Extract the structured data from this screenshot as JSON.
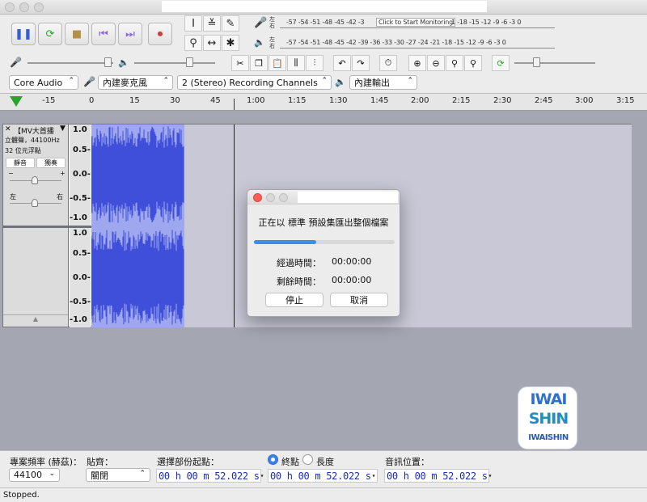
{
  "window": {
    "title": ""
  },
  "meters": {
    "rec": {
      "l": "左",
      "r": "右",
      "scale": "-57 -54 -51 -48 -45 -42 -3",
      "click": "Click to Start Monitoring",
      "scale2": "1 -18 -15 -12 -9 -6 -3 0"
    },
    "play": {
      "l": "左",
      "r": "右",
      "scale": "-57 -54 -51 -48 -45 -42 -39 -36 -33 -30 -27 -24 -21 -18 -15 -12 -9 -6 -3 0"
    }
  },
  "devices": {
    "host": "Core Audio",
    "mic": "內建麥克風",
    "channels": "2 (Stereo) Recording Channels",
    "out": "內建輸出"
  },
  "ruler": [
    "-15",
    "0",
    "15",
    "30",
    "45",
    "1:00",
    "1:15",
    "1:30",
    "1:45",
    "2:00",
    "2:15",
    "2:30",
    "2:45",
    "3:00",
    "3:15"
  ],
  "track": {
    "name": "【MV大首播",
    "info1": "立體聲，44100Hz",
    "info2": "32 位元浮點",
    "mute": "靜音",
    "solo": "獨奏",
    "gain_minus": "−",
    "gain_plus": "+",
    "pan_l": "左",
    "pan_r": "右",
    "scale": [
      "1.0",
      "0.5-",
      "0.0-",
      "-0.5-",
      "-1.0"
    ]
  },
  "dialog": {
    "title": "",
    "message": "正在以 標準 預設集匯出整個檔案",
    "progress": 0.44,
    "elapsed_label": "經過時間：",
    "elapsed": "00:00:00",
    "remaining_label": "剩餘時間：",
    "remaining": "00:00:00",
    "stop": "停止",
    "cancel": "取消"
  },
  "bottom": {
    "rate_label": "專案頻率 (赫茲)：",
    "rate": "44100",
    "snap_label": "貼齊：",
    "snap": "關閉",
    "sel_label": "選擇部份起點：",
    "end_label": "終點",
    "len_label": "長度",
    "pos_label": "音訊位置：",
    "t1": "00 h 00 m 52.022 s",
    "t2": "00 h 00 m 52.022 s",
    "t3": "00 h 00 m 52.022 s"
  },
  "status": "Stopped.",
  "logo": {
    "line1": "IWAI",
    "line2": "SHIN",
    "line3": "IWAISHIN"
  },
  "colors": {
    "wave": "#3f4fd9",
    "progress": "#3a8ee6",
    "time": "#1b2fae"
  }
}
